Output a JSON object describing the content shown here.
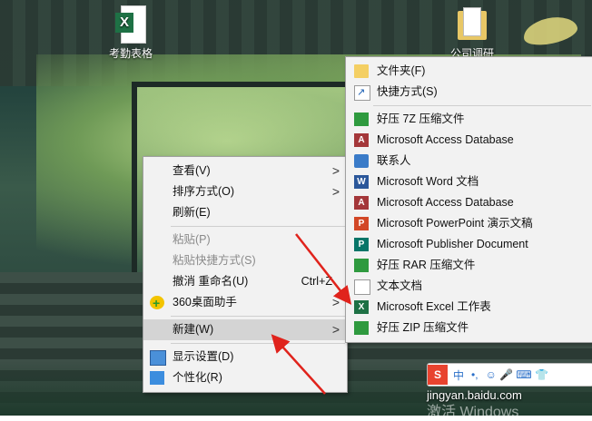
{
  "desktop": {
    "icons": [
      {
        "label": "考勤表格"
      },
      {
        "label": "公司调研"
      }
    ]
  },
  "context_menu": {
    "items": [
      {
        "label": "查看(V)",
        "submenu": true
      },
      {
        "label": "排序方式(O)",
        "submenu": true
      },
      {
        "label": "刷新(E)"
      },
      {
        "label": "粘贴(P)",
        "disabled": true
      },
      {
        "label": "粘贴快捷方式(S)",
        "disabled": true
      },
      {
        "label": "撤消 重命名(U)",
        "shortcut": "Ctrl+Z"
      },
      {
        "label": "360桌面助手",
        "submenu": true,
        "icon": "360-icon"
      },
      {
        "label": "新建(W)",
        "submenu": true,
        "highlighted": true
      },
      {
        "label": "显示设置(D)",
        "icon": "display-icon"
      },
      {
        "label": "个性化(R)",
        "icon": "personalize-icon"
      }
    ]
  },
  "new_submenu": {
    "items": [
      {
        "label": "文件夹(F)",
        "icon": "folder-icon"
      },
      {
        "label": "快捷方式(S)",
        "icon": "shortcut-icon"
      },
      {
        "label": "好压 7Z 压缩文件",
        "icon": "haozip-icon"
      },
      {
        "label": "Microsoft Access Database",
        "icon": "access-icon"
      },
      {
        "label": "联系人",
        "icon": "contact-icon"
      },
      {
        "label": "Microsoft Word 文档",
        "icon": "word-icon"
      },
      {
        "label": "Microsoft Access Database",
        "icon": "access-icon"
      },
      {
        "label": "Microsoft PowerPoint 演示文稿",
        "icon": "powerpoint-icon"
      },
      {
        "label": "Microsoft Publisher Document",
        "icon": "publisher-icon"
      },
      {
        "label": "好压 RAR 压缩文件",
        "icon": "haozip-icon"
      },
      {
        "label": "文本文档",
        "icon": "text-doc-icon"
      },
      {
        "label": "Microsoft Excel 工作表",
        "icon": "excel-icon"
      },
      {
        "label": "好压 ZIP 压缩文件",
        "icon": "haozip-icon"
      }
    ]
  },
  "ime_bar": {
    "logo": "S",
    "mode": "中",
    "punct": "•,",
    "extras": "☺ 🎤 ⌨ 👕"
  },
  "watermark": {
    "text": "jingyan.baidu.com",
    "windows_text": "激活 Windows"
  },
  "colors": {
    "menu_bg": "#f2f2f2",
    "highlight": "#d4d4d4",
    "arrow": "#e0231c",
    "excel_green": "#1e7145"
  }
}
